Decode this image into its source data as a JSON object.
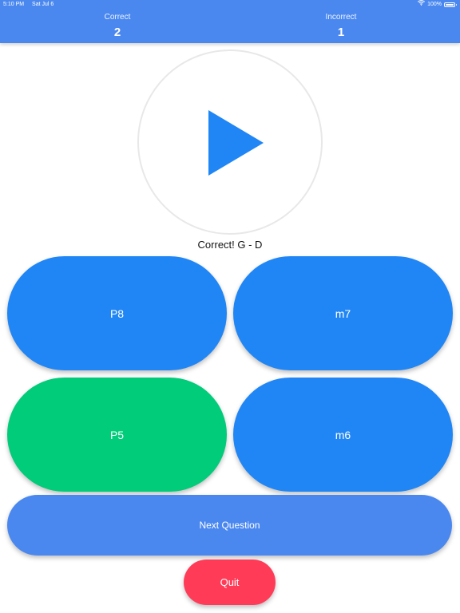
{
  "status_bar": {
    "time": "5:10 PM",
    "date": "Sat Jul 6",
    "battery": "100%",
    "wifi_icon": "wifi-icon",
    "battery_icon": "battery-icon"
  },
  "score": {
    "correct_label": "Correct",
    "correct_value": "2",
    "incorrect_label": "Incorrect",
    "incorrect_value": "1"
  },
  "player": {
    "icon": "play-icon",
    "color": "#2086f5"
  },
  "feedback": "Correct! G - D",
  "answers": [
    {
      "label": "P8",
      "state": "default",
      "color": "#2086f5"
    },
    {
      "label": "m7",
      "state": "default",
      "color": "#2086f5"
    },
    {
      "label": "P5",
      "state": "correct",
      "color": "#00cc7a"
    },
    {
      "label": "m6",
      "state": "default",
      "color": "#2086f5"
    }
  ],
  "next_button": {
    "label": "Next Question",
    "color": "#4a88f0"
  },
  "quit_button": {
    "label": "Quit",
    "color": "#ff3b57"
  },
  "colors": {
    "header": "#4a88f0",
    "accent_blue": "#2086f5",
    "correct_green": "#00cc7a",
    "quit_red": "#ff3b57"
  }
}
